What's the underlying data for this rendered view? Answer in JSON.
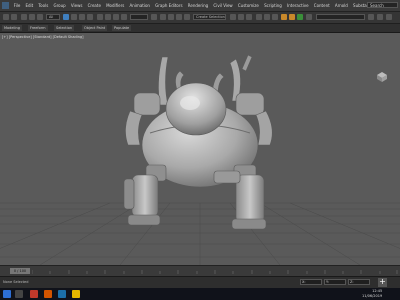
{
  "menus": [
    "File",
    "Edit",
    "Tools",
    "Group",
    "Views",
    "Create",
    "Modifiers",
    "Animation",
    "Graph Editors",
    "Rendering",
    "Civil View",
    "Customize",
    "Scripting",
    "Interactive",
    "Content",
    "Arnold",
    "Substance",
    "Help"
  ],
  "search_placeholder": "Search",
  "toolbar": {
    "selection_filter": "All",
    "selection_set": "Create Selection Set"
  },
  "ribbon_tabs": [
    "Modeling",
    "Freeform",
    "Selection",
    "Object Paint",
    "Populate"
  ],
  "viewport": {
    "label": "[+] [Perspective] [Standard] [Default Shading]"
  },
  "timeline": {
    "frame_display": "0 / 100"
  },
  "status": {
    "text": "None Selected",
    "x_value": "X:",
    "y_value": "Y:",
    "z_value": "Z:",
    "grid": "Grid = 10.0",
    "add_time_tag": "Add Time Tag"
  },
  "taskbar": {
    "time": "12:45",
    "date": "11/06/2019"
  },
  "colors": {
    "accent": "#3f7fbf",
    "viewport_bg": "#5a5a5a",
    "model": "#b0b0b0"
  }
}
